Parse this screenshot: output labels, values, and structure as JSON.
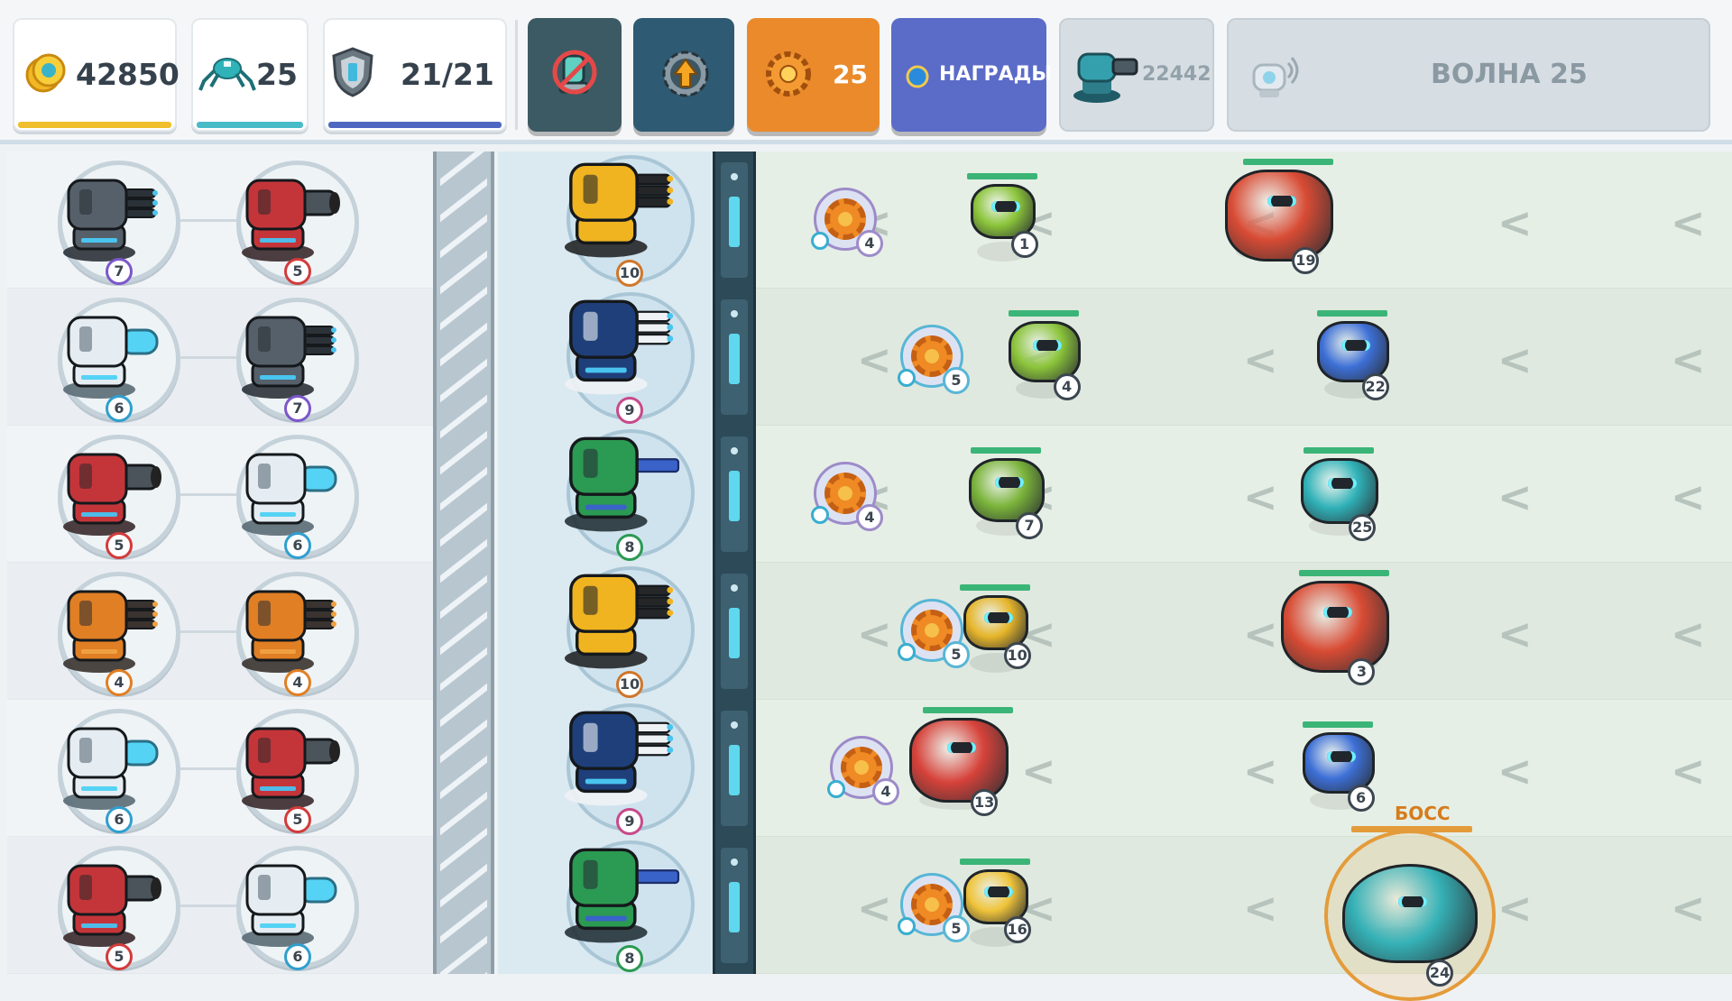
{
  "hud": {
    "coins": "42850",
    "bugs": "25",
    "shield": "21/21",
    "crystals_btn": "25",
    "rewards_btn": "НАГРАДЫ",
    "turret_power": "22442",
    "wave": "ВОЛНА 25"
  },
  "colors": {
    "coin_bar": "#f0bf2e",
    "bug_bar": "#48bbc8",
    "shield_bar": "#4e68c2",
    "btn_dark": "#3c5a63",
    "btn_blue": "#2f5a73",
    "btn_orange": "#ea8a2b",
    "btn_purple": "#5b6bc8",
    "btn_grey": "#d7dee3"
  },
  "inventory": [
    [
      {
        "type": "gatling-grey",
        "level": "7"
      },
      {
        "type": "cannon-red",
        "level": "5"
      }
    ],
    [
      {
        "type": "laser-white",
        "level": "6"
      },
      {
        "type": "gatling-grey",
        "level": "7"
      }
    ],
    [
      {
        "type": "cannon-red",
        "level": "5"
      },
      {
        "type": "laser-white",
        "level": "6"
      }
    ],
    [
      {
        "type": "gatling-orange",
        "level": "4"
      },
      {
        "type": "gatling-orange",
        "level": "4"
      }
    ],
    [
      {
        "type": "laser-white",
        "level": "6"
      },
      {
        "type": "cannon-red",
        "level": "5"
      }
    ],
    [
      {
        "type": "cannon-red",
        "level": "5"
      },
      {
        "type": "laser-white",
        "level": "6"
      }
    ]
  ],
  "defense": [
    {
      "type": "gatling-gold",
      "level": "10"
    },
    {
      "type": "gatling-navy",
      "level": "9"
    },
    {
      "type": "railgun-green",
      "level": "8"
    },
    {
      "type": "gatling-gold",
      "level": "10"
    },
    {
      "type": "gatling-navy",
      "level": "9"
    },
    {
      "type": "railgun-green",
      "level": "8"
    }
  ],
  "lanes": [
    {
      "mine": "4",
      "mine_outline": "purple",
      "enemies": [
        {
          "kind": "green-wheel-bot",
          "level": "1"
        },
        {
          "kind": "red-mech-walker",
          "level": "19"
        }
      ]
    },
    {
      "mine": "5",
      "mine_outline": "blue",
      "enemies": [
        {
          "kind": "green-humanoid",
          "level": "4"
        },
        {
          "kind": "blue-hover-drone",
          "level": "22"
        }
      ]
    },
    {
      "mine": "4",
      "mine_outline": "purple",
      "enemies": [
        {
          "kind": "green-shield-bot",
          "level": "7"
        },
        {
          "kind": "teal-spider",
          "level": "25"
        }
      ]
    },
    {
      "mine": "5",
      "mine_outline": "blue",
      "enemies": [
        {
          "kind": "yellow-wheel-bot",
          "level": "10"
        },
        {
          "kind": "red-mech-walker",
          "level": "3"
        }
      ]
    },
    {
      "mine": "4",
      "mine_outline": "purple",
      "enemies": [
        {
          "kind": "red-crab",
          "level": "13"
        },
        {
          "kind": "blue-hover-drone",
          "level": "6"
        }
      ]
    },
    {
      "mine": "5",
      "mine_outline": "blue",
      "enemies": [
        {
          "kind": "yellow-dome-bot",
          "level": "16"
        },
        {
          "kind": "teal-ufo-boss",
          "level": "24"
        }
      ]
    }
  ],
  "boss_label": "БОСС"
}
